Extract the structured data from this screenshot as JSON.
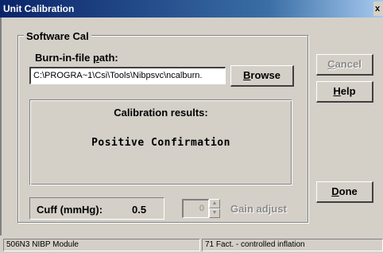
{
  "window": {
    "title": "Unit Calibration",
    "close_glyph": "x"
  },
  "group": {
    "legend": "Software Cal"
  },
  "path": {
    "label_pre": "Burn-in-file ",
    "label_accel": "p",
    "label_post": "ath:",
    "value": "C:\\PROGRA~1\\Csi\\Tools\\Nibpsvc\\ncalburn."
  },
  "buttons": {
    "browse_accel": "B",
    "browse_rest": "rowse",
    "cancel_accel": "C",
    "cancel_rest": "ancel",
    "help_accel": "H",
    "help_rest": "elp",
    "done_accel": "D",
    "done_rest": "one"
  },
  "results": {
    "title": "Calibration results:",
    "value": "Positive Confirmation"
  },
  "cuff": {
    "label": "Cuff (mmHg):",
    "value": "0.5"
  },
  "gain": {
    "value": "0",
    "label": "Gain adjust",
    "up_glyph": "▲",
    "down_glyph": "▼"
  },
  "statusbar": {
    "module": "506N3 NIBP Module",
    "mode": "71 Fact. - controlled inflation"
  }
}
